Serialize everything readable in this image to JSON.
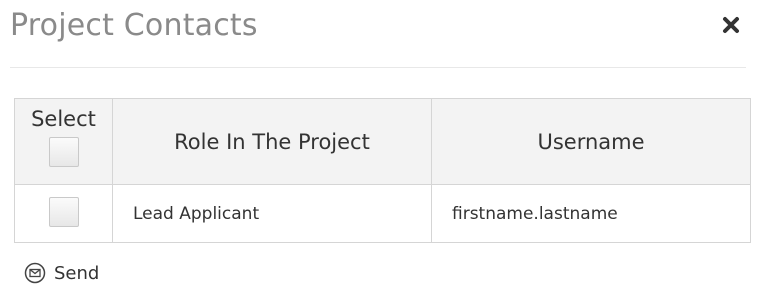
{
  "dialog": {
    "title": "Project Contacts",
    "close_icon": "close-icon"
  },
  "table": {
    "headers": {
      "select": "Select",
      "role": "Role In The Project",
      "username": "Username"
    },
    "rows": [
      {
        "selected": false,
        "role": "Lead Applicant",
        "username": "firstname.lastname"
      }
    ]
  },
  "actions": {
    "send_label": "Send",
    "send_icon": "envelope-icon"
  }
}
